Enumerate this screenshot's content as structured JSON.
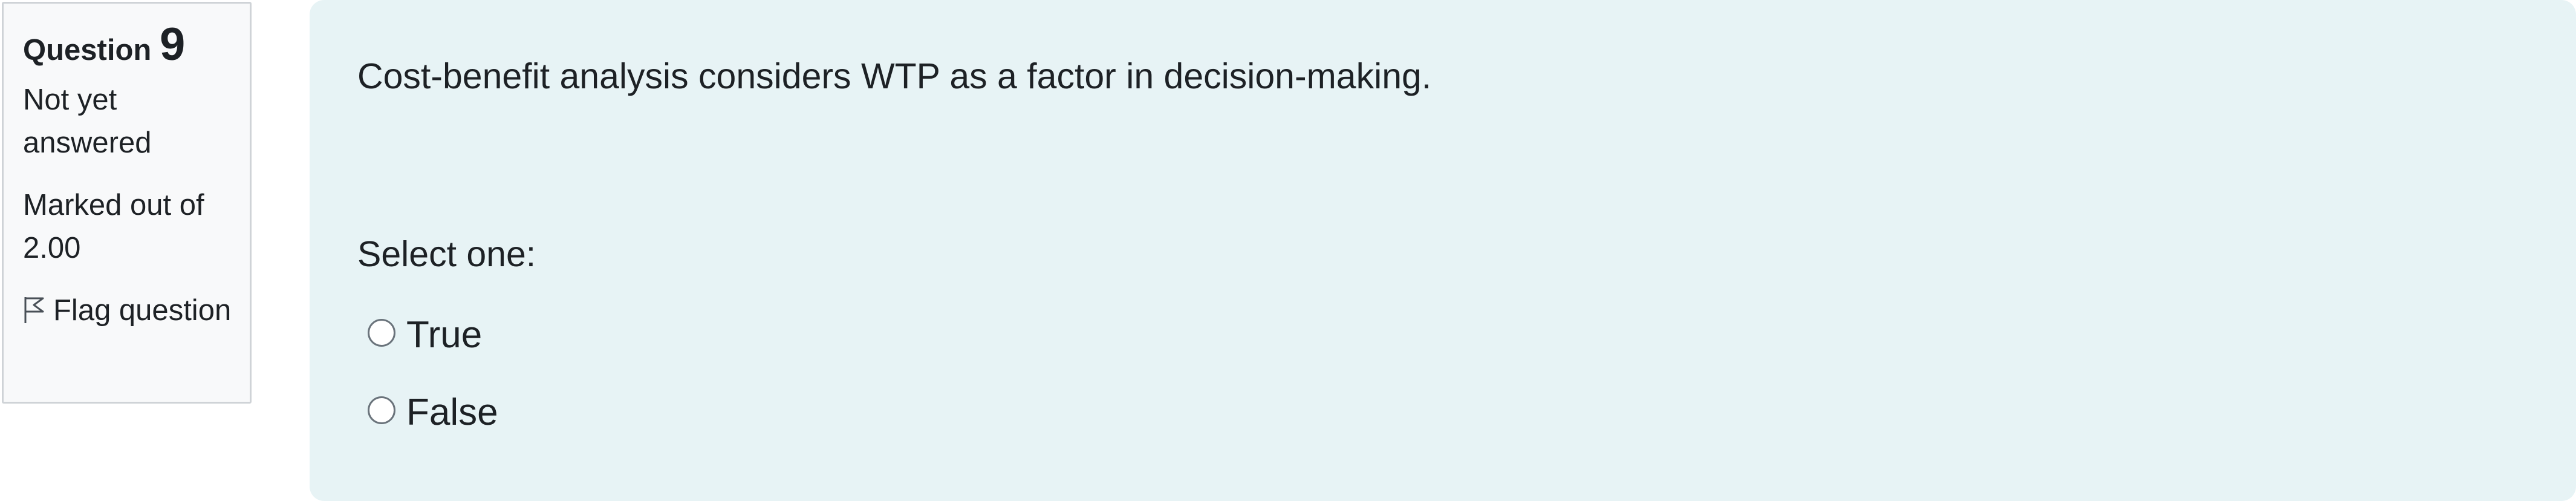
{
  "question": {
    "label": "Question",
    "number": "9",
    "status": "Not yet answered",
    "marks": "Marked out of 2.00",
    "flag_label": "Flag question",
    "flag_icon": "flag-outline-icon"
  },
  "content": {
    "text": "Cost-benefit analysis considers WTP as a factor in decision-making.",
    "prompt": "Select one:",
    "options": [
      {
        "label": "True",
        "selected": false
      },
      {
        "label": "False",
        "selected": false
      }
    ]
  }
}
